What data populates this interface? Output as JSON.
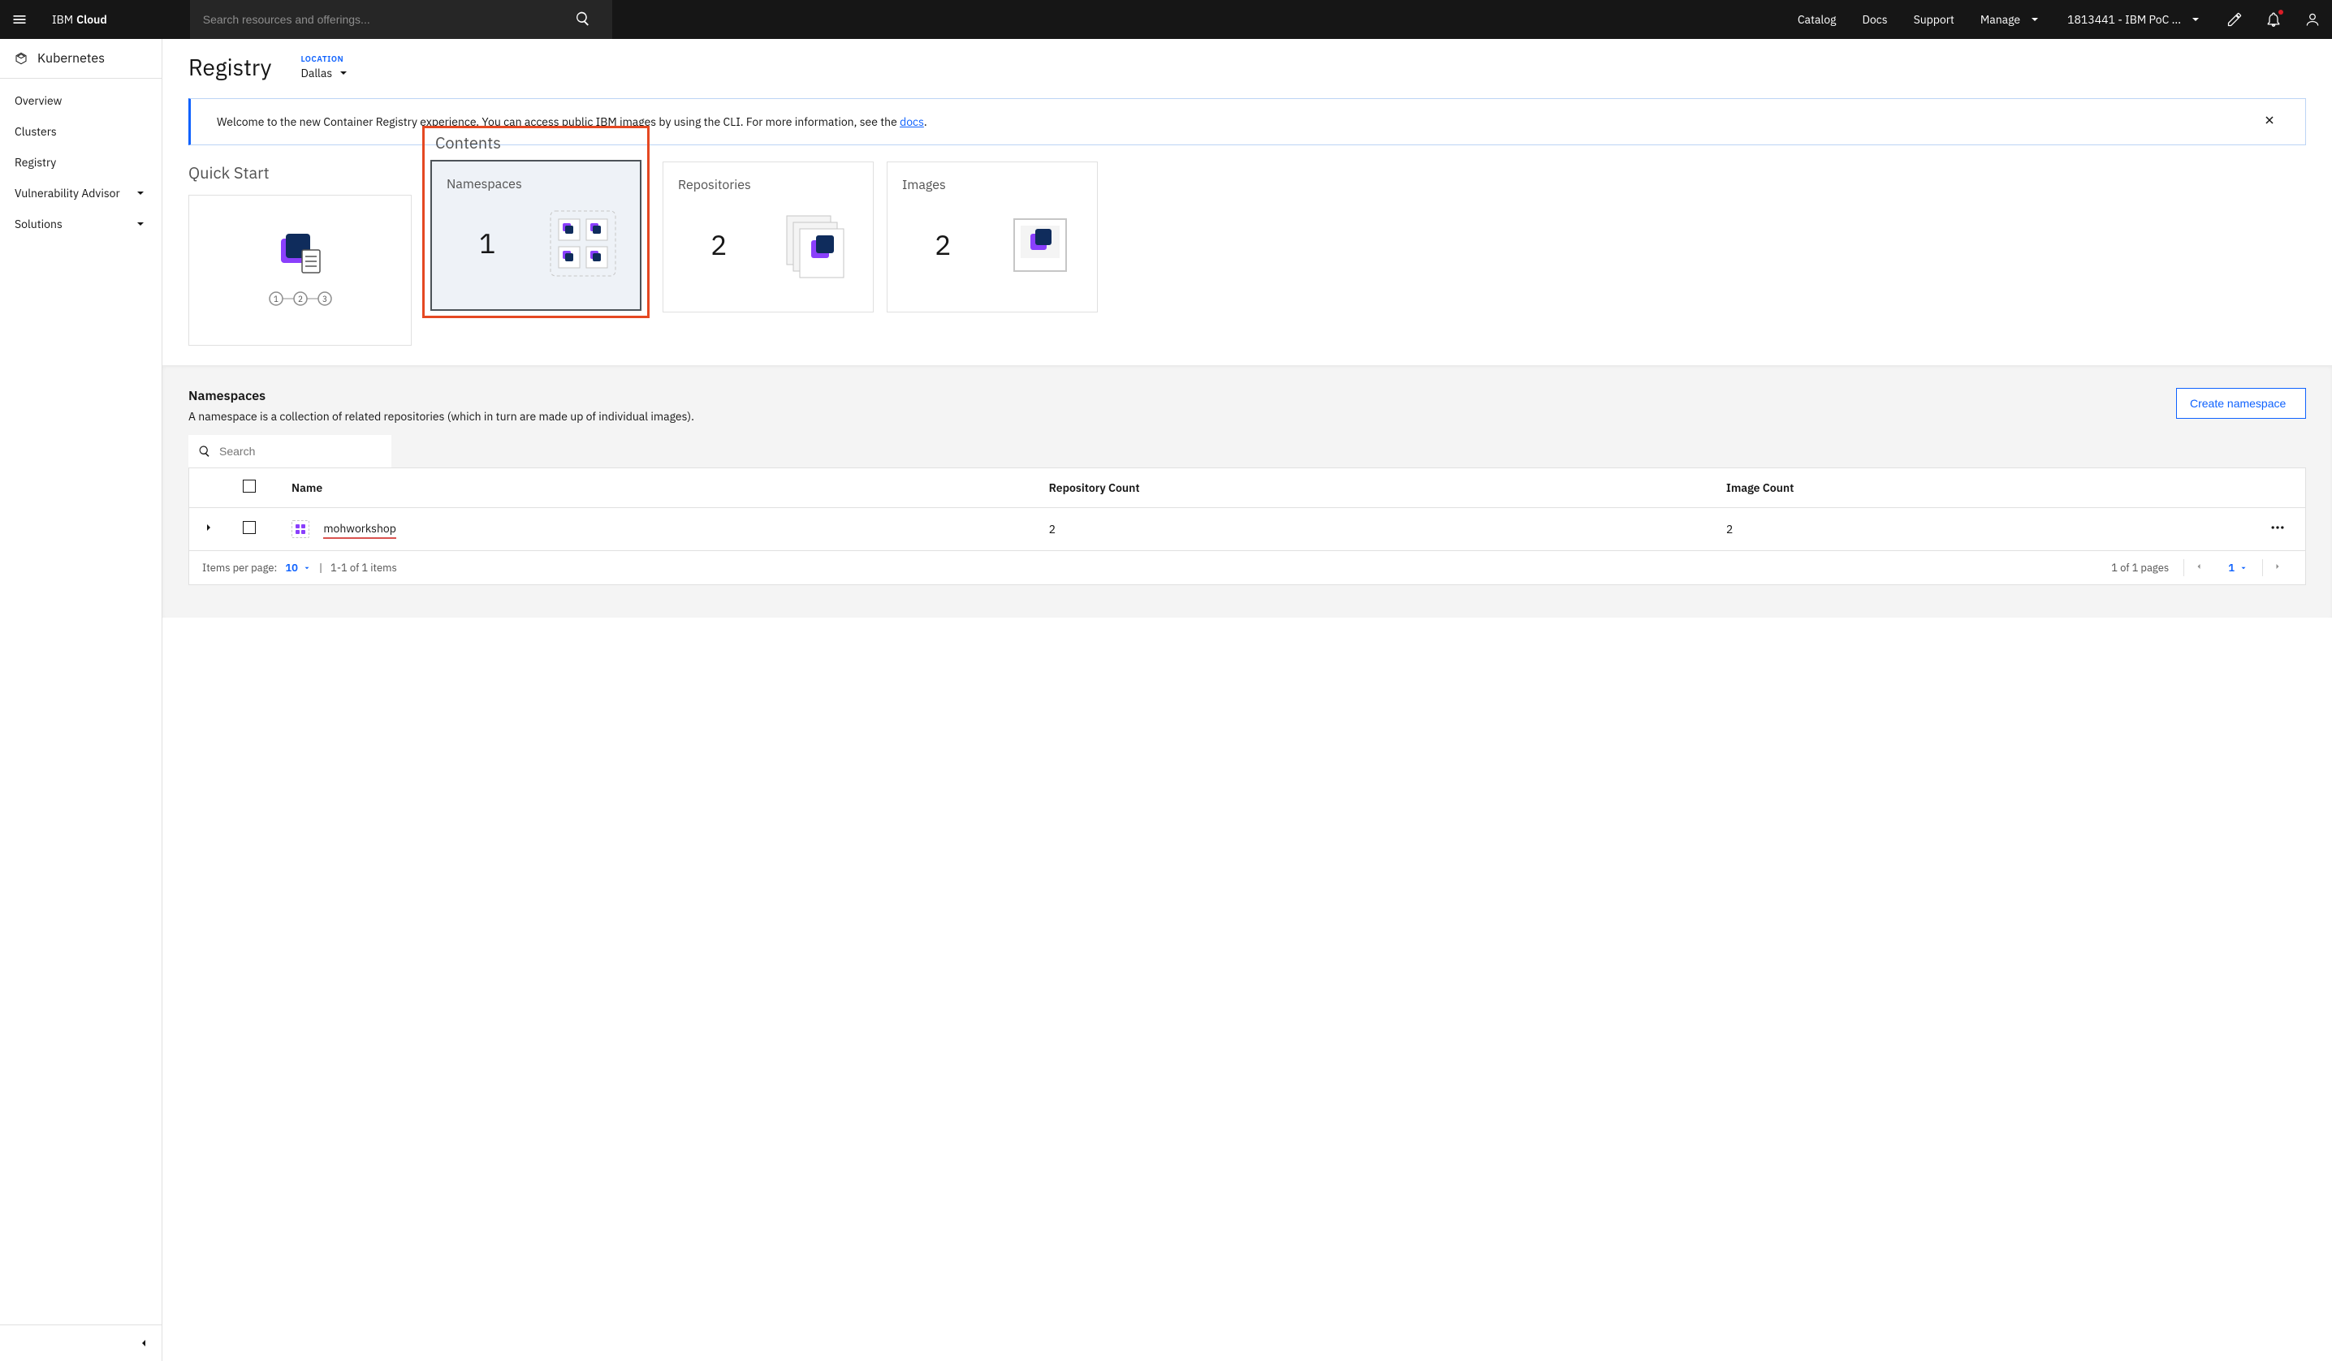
{
  "header": {
    "brand_prefix": "IBM",
    "brand_suffix": "Cloud",
    "search_placeholder": "Search resources and offerings...",
    "links": {
      "catalog": "Catalog",
      "docs": "Docs",
      "support": "Support",
      "manage": "Manage"
    },
    "account": "1813441 - IBM PoC ..."
  },
  "sidebar": {
    "title": "Kubernetes",
    "items": [
      {
        "label": "Overview"
      },
      {
        "label": "Clusters"
      },
      {
        "label": "Registry"
      },
      {
        "label": "Vulnerability Advisor",
        "expandable": true
      },
      {
        "label": "Solutions",
        "expandable": true
      }
    ]
  },
  "page": {
    "title": "Registry",
    "location_label": "LOCATION",
    "location_value": "Dallas"
  },
  "banner": {
    "text_before": "Welcome to the new Container Registry experience. You can access public IBM images by using the CLI. For more information, see the ",
    "link_text": "docs",
    "text_after": "."
  },
  "sections": {
    "quickstart_label": "Quick Start",
    "contents_label": "Contents",
    "cards": {
      "namespaces": {
        "title": "Namespaces",
        "count": "1"
      },
      "repositories": {
        "title": "Repositories",
        "count": "2"
      },
      "images": {
        "title": "Images",
        "count": "2"
      }
    }
  },
  "namespaces": {
    "heading": "Namespaces",
    "description": "A namespace is a collection of related repositories (which in turn are made up of individual images).",
    "create_button": "Create namespace",
    "search_placeholder": "Search",
    "columns": {
      "name": "Name",
      "repo_count": "Repository Count",
      "img_count": "Image Count"
    },
    "rows": [
      {
        "name": "mohworkshop",
        "repo_count": "2",
        "image_count": "2"
      }
    ],
    "footer": {
      "items_per_page_label": "Items per page:",
      "items_per_page_value": "10",
      "range_text": "1-1 of 1 items",
      "pages_text": "1 of 1 pages",
      "current_page": "1"
    }
  }
}
